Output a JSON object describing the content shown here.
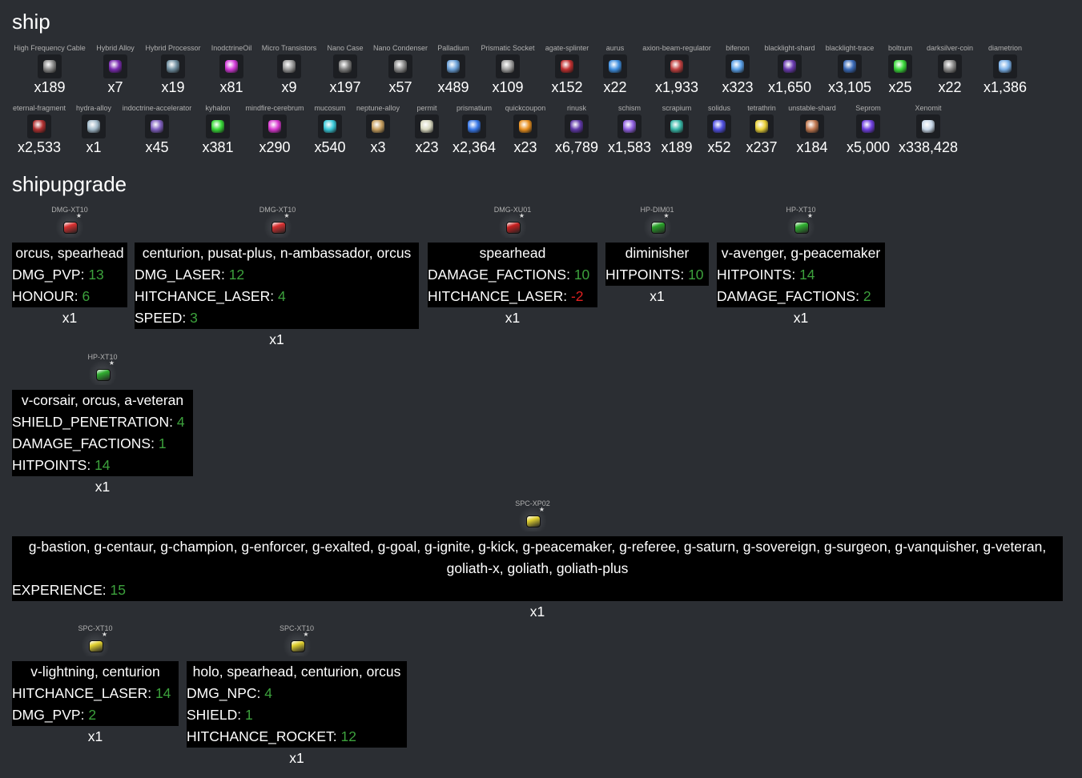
{
  "sections": {
    "ship": "ship",
    "shipupgrade": "shipupgrade"
  },
  "ship_items_row1": [
    {
      "name": "High Frequency Cable",
      "count": "x189",
      "color": "#8a8a8a"
    },
    {
      "name": "Hybrid Alloy",
      "count": "x7",
      "color": "#7a2bb0"
    },
    {
      "name": "Hybrid Processor",
      "count": "x19",
      "color": "#6f8ea0"
    },
    {
      "name": "InodctrineOil",
      "count": "x81",
      "color": "#d23ad8"
    },
    {
      "name": "Micro Transistors",
      "count": "x9",
      "color": "#9a9a9a"
    },
    {
      "name": "Nano Case",
      "count": "x197",
      "color": "#7d7d7d"
    },
    {
      "name": "Nano Condenser",
      "count": "x57",
      "color": "#8c8c8c"
    },
    {
      "name": "Palladium",
      "count": "x489",
      "color": "#6aa0d8"
    },
    {
      "name": "Prismatic Socket",
      "count": "x109",
      "color": "#a0a0a0"
    },
    {
      "name": "agate-splinter",
      "count": "x152",
      "color": "#c03030"
    },
    {
      "name": "aurus",
      "count": "x22",
      "color": "#3f8fe0"
    },
    {
      "name": "axion-beam-regulator",
      "count": "x1,933",
      "color": "#c04040"
    },
    {
      "name": "bifenon",
      "count": "x323",
      "color": "#5aa0e8"
    },
    {
      "name": "blacklight-shard",
      "count": "x1,650",
      "color": "#6a3ab0"
    },
    {
      "name": "blacklight-trace",
      "count": "x3,105",
      "color": "#3a6ab8"
    },
    {
      "name": "boltrum",
      "count": "x25",
      "color": "#3ad83a"
    },
    {
      "name": "darksilver-coin",
      "count": "x22",
      "color": "#8a8a8a"
    },
    {
      "name": "diametrion",
      "count": "x1,386",
      "color": "#7ab0e8"
    }
  ],
  "ship_items_row2": [
    {
      "name": "eternal-fragment",
      "count": "x2,533",
      "color": "#b03030"
    },
    {
      "name": "hydra-alloy",
      "count": "x1",
      "color": "#a0b8c8"
    },
    {
      "name": "indoctrine-accelerator",
      "count": "x45",
      "color": "#8060c0"
    },
    {
      "name": "kyhalon",
      "count": "x381",
      "color": "#38d838"
    },
    {
      "name": "mindfire-cerebrum",
      "count": "x290",
      "color": "#d838d0"
    },
    {
      "name": "mucosum",
      "count": "x540",
      "color": "#38c8d8"
    },
    {
      "name": "neptune-alloy",
      "count": "x3",
      "color": "#c8a060"
    },
    {
      "name": "permit",
      "count": "x23",
      "color": "#d8d8c0"
    },
    {
      "name": "prismatium",
      "count": "x2,364",
      "color": "#3878e8"
    },
    {
      "name": "quickcoupon",
      "count": "x23",
      "color": "#e89020"
    },
    {
      "name": "rinusk",
      "count": "x6,789",
      "color": "#6038a8"
    },
    {
      "name": "schism",
      "count": "x1,583",
      "color": "#9060e0"
    },
    {
      "name": "scrapium",
      "count": "x189",
      "color": "#38b8a8"
    },
    {
      "name": "solidus",
      "count": "x52",
      "color": "#5050e0"
    },
    {
      "name": "tetrathrin",
      "count": "x237",
      "color": "#e8d038"
    },
    {
      "name": "unstable-shard",
      "count": "x184",
      "color": "#c07850"
    },
    {
      "name": "Seprom",
      "count": "x5,000",
      "color": "#7040e0"
    },
    {
      "name": "Xenomit",
      "count": "x338,428",
      "color": "#c8d8e8"
    }
  ],
  "upgrades": [
    {
      "code": "DMG-XT10",
      "color": "#d83030",
      "ships": "orcus, spearhead",
      "qty": "x1",
      "stats": [
        {
          "k": "DMG_PVP: ",
          "v": "13",
          "neg": false
        },
        {
          "k": "HONOUR: ",
          "v": "6",
          "neg": false
        }
      ]
    },
    {
      "code": "DMG-XT10",
      "color": "#d83030",
      "ships": "centurion, pusat-plus, n-ambassador, orcus",
      "qty": "x1",
      "stats": [
        {
          "k": "DMG_LASER: ",
          "v": "12",
          "neg": false
        },
        {
          "k": "HITCHANCE_LASER: ",
          "v": "4",
          "neg": false
        },
        {
          "k": "SPEED: ",
          "v": "3",
          "neg": false
        }
      ]
    },
    {
      "code": "DMG-XU01",
      "color": "#c82020",
      "ships": "spearhead",
      "qty": "x1",
      "stats": [
        {
          "k": "DAMAGE_FACTIONS: ",
          "v": "10",
          "neg": false
        },
        {
          "k": "HITCHANCE_LASER: ",
          "v": "-2",
          "neg": true
        }
      ]
    },
    {
      "code": "HP-DIM01",
      "color": "#28a028",
      "ships": "diminisher",
      "qty": "x1",
      "stats": [
        {
          "k": "HITPOINTS: ",
          "v": "10",
          "neg": false
        }
      ]
    },
    {
      "code": "HP-XT10",
      "color": "#30b030",
      "ships": "v-avenger, g-peacemaker",
      "qty": "x1",
      "stats": [
        {
          "k": "HITPOINTS: ",
          "v": "14",
          "neg": false
        },
        {
          "k": "DAMAGE_FACTIONS: ",
          "v": "2",
          "neg": false
        }
      ]
    },
    {
      "code": "HP-XT10",
      "color": "#30b030",
      "ships": "v-corsair, orcus, a-veteran",
      "qty": "x1",
      "stats": [
        {
          "k": "SHIELD_PENETRATION: ",
          "v": "4",
          "neg": false
        },
        {
          "k": "DAMAGE_FACTIONS: ",
          "v": "1",
          "neg": false
        },
        {
          "k": "HITPOINTS: ",
          "v": "14",
          "neg": false
        }
      ]
    },
    {
      "code": "SPC-XP02",
      "color": "#e0d030",
      "ships": "g-bastion, g-centaur, g-champion, g-enforcer, g-exalted, g-goal, g-ignite, g-kick, g-peacemaker, g-referee, g-saturn, g-sovereign, g-surgeon, g-vanquisher, g-veteran, goliath-x, goliath, goliath-plus",
      "qty": "x1",
      "stats": [
        {
          "k": "EXPERIENCE: ",
          "v": "15",
          "neg": false
        }
      ]
    },
    {
      "code": "SPC-XT10",
      "color": "#e0d030",
      "ships": "v-lightning, centurion",
      "qty": "x1",
      "stats": [
        {
          "k": "HITCHANCE_LASER: ",
          "v": "14",
          "neg": false
        },
        {
          "k": "DMG_PVP: ",
          "v": "2",
          "neg": false
        }
      ]
    },
    {
      "code": "SPC-XT10",
      "color": "#e0d030",
      "ships": "holo, spearhead, centurion, orcus",
      "qty": "x1",
      "stats": [
        {
          "k": "DMG_NPC: ",
          "v": "4",
          "neg": false
        },
        {
          "k": "SHIELD: ",
          "v": "1",
          "neg": false
        },
        {
          "k": "HITCHANCE_ROCKET: ",
          "v": "12",
          "neg": false
        }
      ]
    }
  ]
}
